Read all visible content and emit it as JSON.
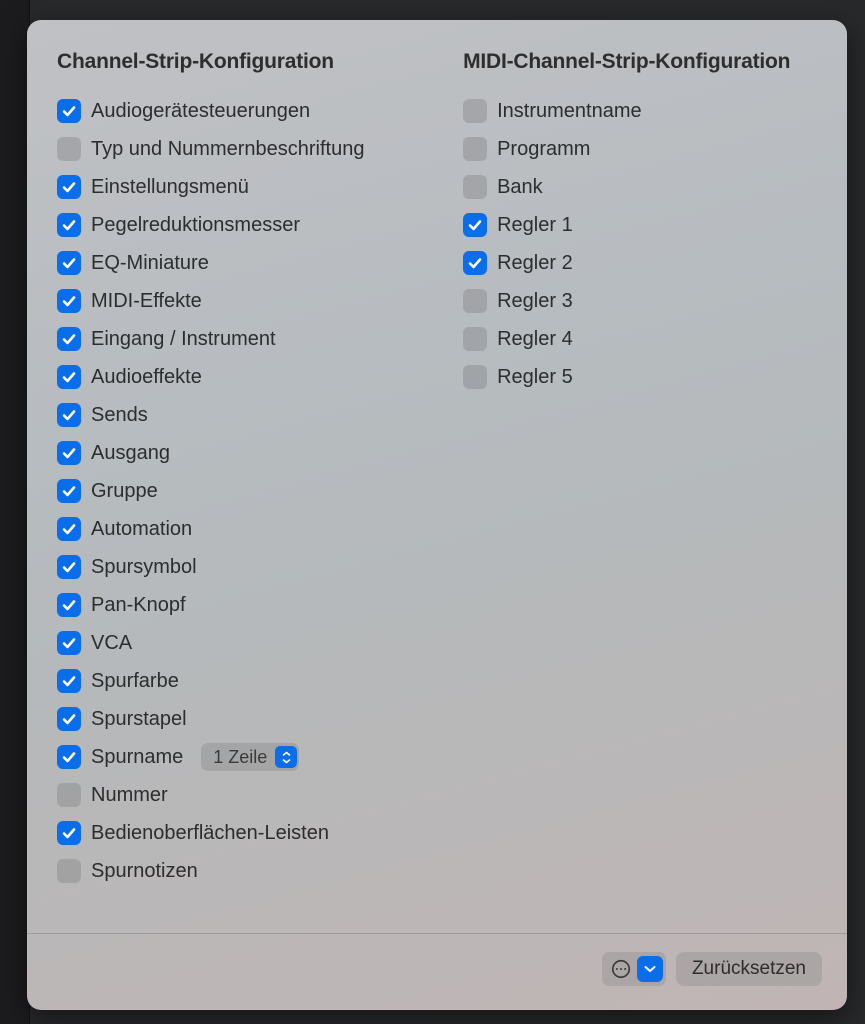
{
  "leftColumn": {
    "header": "Channel-Strip-Konfiguration",
    "items": [
      {
        "label": "Audiogerätesteuerungen",
        "checked": true
      },
      {
        "label": "Typ und Nummernbeschriftung",
        "checked": false
      },
      {
        "label": "Einstellungsmenü",
        "checked": true
      },
      {
        "label": "Pegelreduktionsmesser",
        "checked": true
      },
      {
        "label": "EQ-Miniature",
        "checked": true
      },
      {
        "label": "MIDI-Effekte",
        "checked": true
      },
      {
        "label": "Eingang / Instrument",
        "checked": true
      },
      {
        "label": "Audioeffekte",
        "checked": true
      },
      {
        "label": "Sends",
        "checked": true
      },
      {
        "label": "Ausgang",
        "checked": true
      },
      {
        "label": "Gruppe",
        "checked": true
      },
      {
        "label": "Automation",
        "checked": true
      },
      {
        "label": "Spursymbol",
        "checked": true
      },
      {
        "label": "Pan-Knopf",
        "checked": true
      },
      {
        "label": "VCA",
        "checked": true
      },
      {
        "label": "Spurfarbe",
        "checked": true
      },
      {
        "label": "Spurstapel",
        "checked": true
      },
      {
        "label": "Spurname",
        "checked": true,
        "dropdown": "1 Zeile"
      },
      {
        "label": "Nummer",
        "checked": false
      },
      {
        "label": "Bedienoberflächen-Leisten",
        "checked": true
      },
      {
        "label": "Spurnotizen",
        "checked": false
      }
    ]
  },
  "rightColumn": {
    "header": "MIDI-Channel-Strip-Konfiguration",
    "items": [
      {
        "label": "Instrumentname",
        "checked": false
      },
      {
        "label": "Programm",
        "checked": false
      },
      {
        "label": "Bank",
        "checked": false
      },
      {
        "label": "Regler 1",
        "checked": true
      },
      {
        "label": "Regler 2",
        "checked": true
      },
      {
        "label": "Regler 3",
        "checked": false
      },
      {
        "label": "Regler 4",
        "checked": false
      },
      {
        "label": "Regler 5",
        "checked": false
      }
    ]
  },
  "footer": {
    "resetLabel": "Zurücksetzen"
  }
}
